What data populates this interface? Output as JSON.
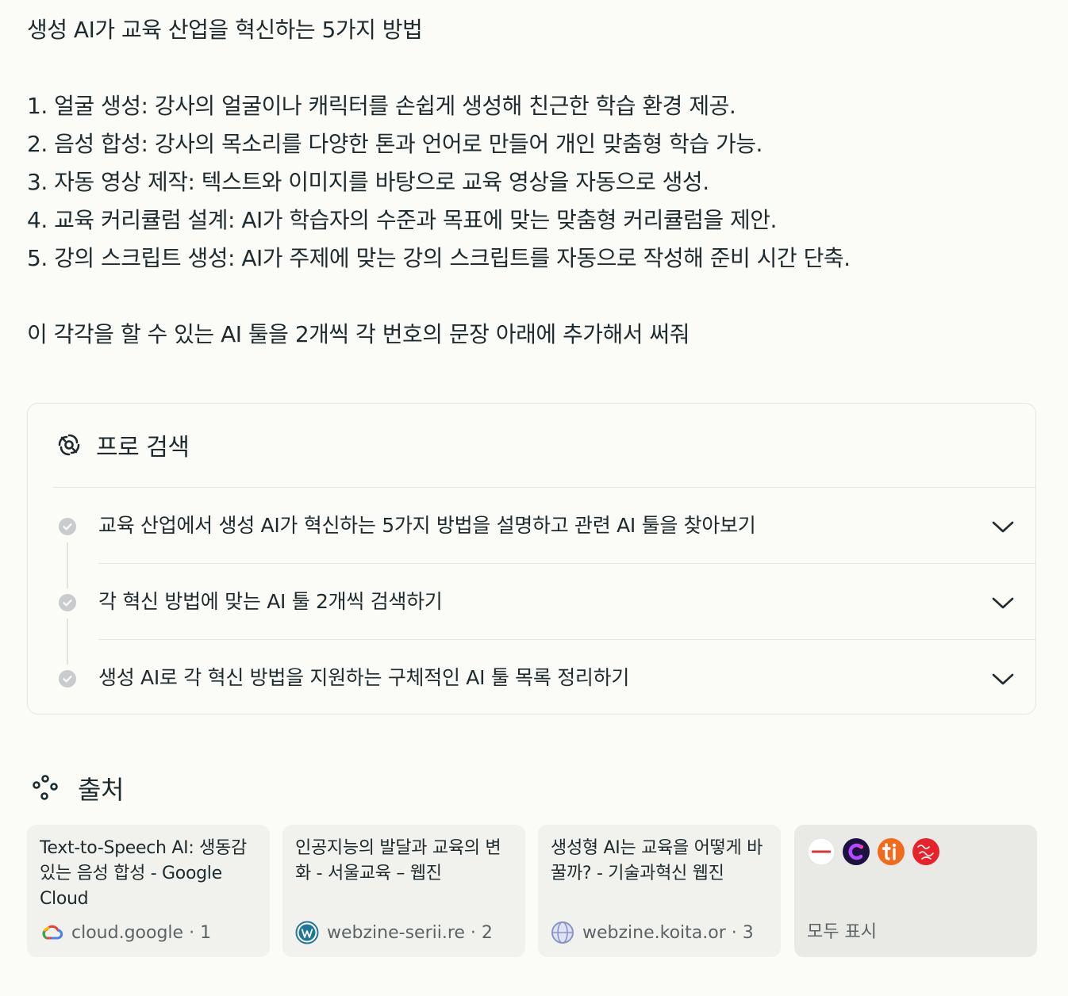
{
  "query": {
    "title": "생성 AI가 교육 산업을 혁신하는 5가지 방법",
    "items": [
      "1. 얼굴 생성: 강사의 얼굴이나 캐릭터를 손쉽게 생성해 친근한 학습 환경 제공.",
      "2. 음성 합성: 강사의 목소리를 다양한 톤과 언어로 만들어 개인 맞춤형 학습 가능.",
      "3. 자동 영상 제작: 텍스트와 이미지를 바탕으로 교육 영상을 자동으로 생성.",
      "4. 교육 커리큘럼 설계: AI가 학습자의 수준과 목표에 맞는 맞춤형 커리큘럼을 제안.",
      "5. 강의 스크립트 생성: AI가 주제에 맞는 강의 스크립트를 자동으로 작성해 준비 시간 단축."
    ],
    "request": "이 각각을 할 수 있는 AI 툴을 2개씩 각 번호의 문장 아래에 추가해서 써줘"
  },
  "pro_search": {
    "title": "프로 검색",
    "steps": [
      "교육 산업에서 생성 AI가 혁신하는 5가지 방법을 설명하고 관련 AI 툴을 찾아보기",
      "각 혁신 방법에 맞는 AI 툴 2개씩 검색하기",
      "생성 AI로 각 혁신 방법을 지원하는 구체적인 AI 툴 목록 정리하기"
    ]
  },
  "sources": {
    "title": "출처",
    "cards": [
      {
        "title": "Text-to-Speech AI: 생동감 있는 음성 합성 - Google Cloud",
        "domain": "cloud.google",
        "index": "1"
      },
      {
        "title": "인공지능의 발달과 교육의 변화 - 서울교육 – 웹진",
        "domain": "webzine-serii.re",
        "index": "2"
      },
      {
        "title": "생성형 AI는 교육을 어떻게 바꿀까? - 기술과혁신 웹진",
        "domain": "webzine.koita.or",
        "index": "3"
      }
    ],
    "more_label": "모두 표시"
  },
  "colors": {
    "background": "#fbfbf8",
    "card": "#f1f1ee",
    "border": "#e6e6e1",
    "text": "#1e2a2d",
    "muted": "#5b6366"
  }
}
